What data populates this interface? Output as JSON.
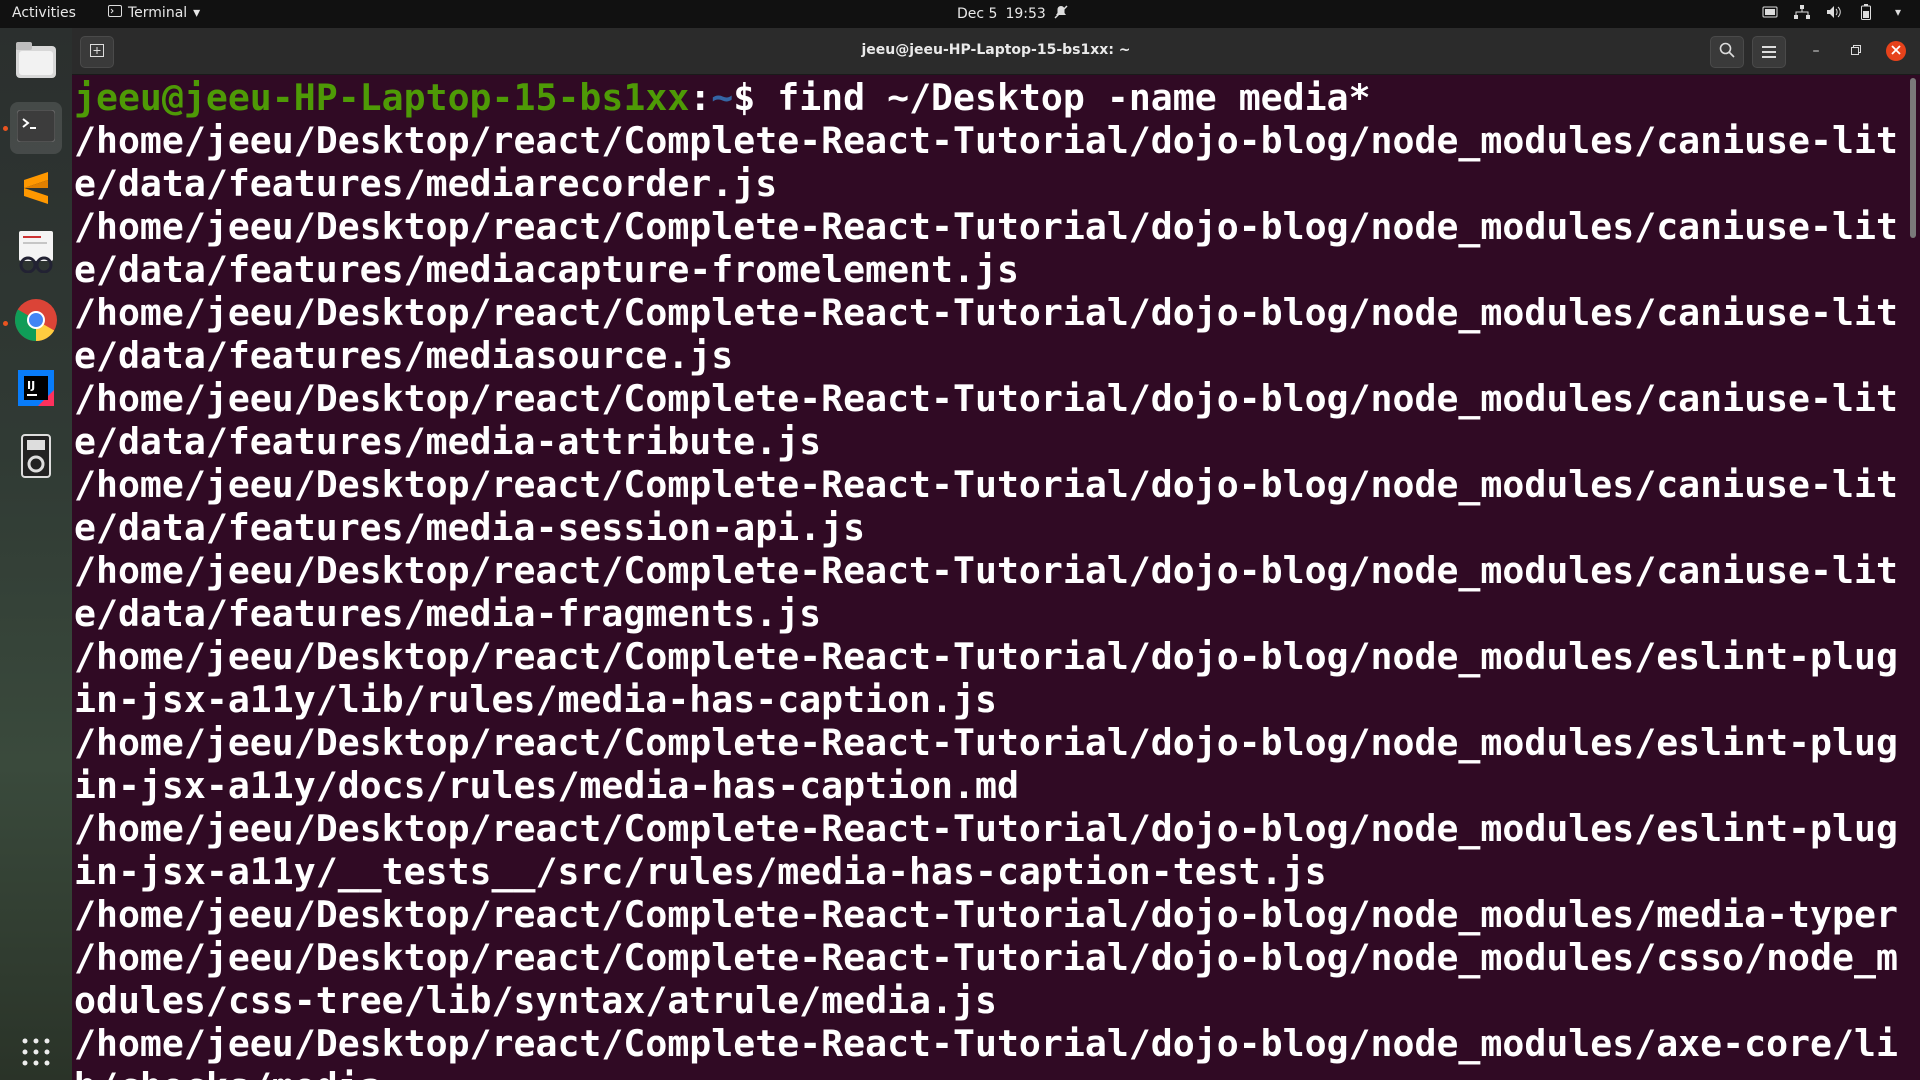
{
  "topbar": {
    "activities": "Activities",
    "app_name": "Terminal",
    "date": "Dec 5",
    "time": "19:53"
  },
  "dock": {
    "items": [
      "files",
      "terminal",
      "sublime-text",
      "document-viewer",
      "chrome",
      "intellij",
      "music-player"
    ]
  },
  "window": {
    "title": "jeeu@jeeu-HP-Laptop-15-bs1xx: ~"
  },
  "terminal": {
    "prompt_user": "jeeu@jeeu-HP-Laptop-15-bs1xx",
    "prompt_sep": ":",
    "prompt_path": "~",
    "prompt_dollar": "$ ",
    "command": "find ~/Desktop -name media*",
    "output_lines": [
      "/home/jeeu/Desktop/react/Complete-React-Tutorial/dojo-blog/node_modules/caniuse-lit",
      "e/data/features/mediarecorder.js",
      "/home/jeeu/Desktop/react/Complete-React-Tutorial/dojo-blog/node_modules/caniuse-lit",
      "e/data/features/mediacapture-fromelement.js",
      "/home/jeeu/Desktop/react/Complete-React-Tutorial/dojo-blog/node_modules/caniuse-lit",
      "e/data/features/mediasource.js",
      "/home/jeeu/Desktop/react/Complete-React-Tutorial/dojo-blog/node_modules/caniuse-lit",
      "e/data/features/media-attribute.js",
      "/home/jeeu/Desktop/react/Complete-React-Tutorial/dojo-blog/node_modules/caniuse-lit",
      "e/data/features/media-session-api.js",
      "/home/jeeu/Desktop/react/Complete-React-Tutorial/dojo-blog/node_modules/caniuse-lit",
      "e/data/features/media-fragments.js",
      "/home/jeeu/Desktop/react/Complete-React-Tutorial/dojo-blog/node_modules/eslint-plug",
      "in-jsx-a11y/lib/rules/media-has-caption.js",
      "/home/jeeu/Desktop/react/Complete-React-Tutorial/dojo-blog/node_modules/eslint-plug",
      "in-jsx-a11y/docs/rules/media-has-caption.md",
      "/home/jeeu/Desktop/react/Complete-React-Tutorial/dojo-blog/node_modules/eslint-plug",
      "in-jsx-a11y/__tests__/src/rules/media-has-caption-test.js",
      "/home/jeeu/Desktop/react/Complete-React-Tutorial/dojo-blog/node_modules/media-typer",
      "/home/jeeu/Desktop/react/Complete-React-Tutorial/dojo-blog/node_modules/csso/node_m",
      "odules/css-tree/lib/syntax/atrule/media.js",
      "/home/jeeu/Desktop/react/Complete-React-Tutorial/dojo-blog/node_modules/axe-core/li",
      "b/checks/media"
    ]
  },
  "colors": {
    "terminal_bg": "#300a24",
    "prompt_user": "#4e9a06",
    "prompt_path": "#3465a4",
    "close_button": "#e6421b"
  }
}
